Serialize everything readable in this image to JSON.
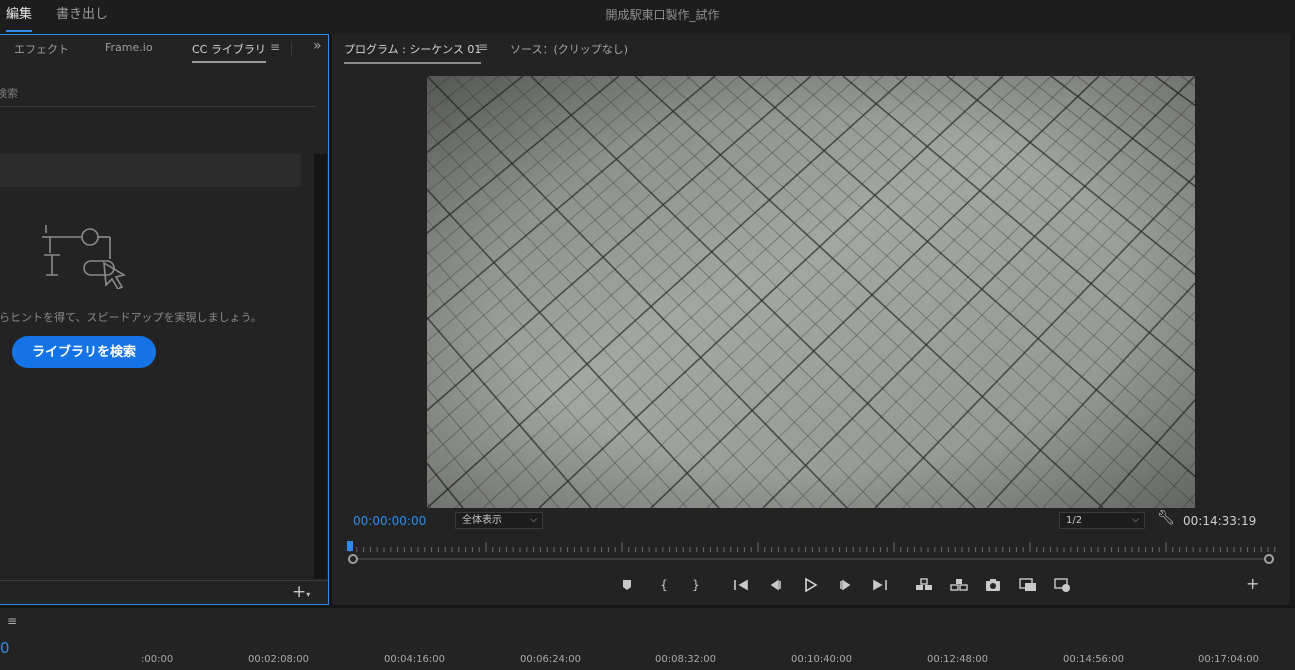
{
  "topbar": {
    "tabs": [
      {
        "label": "編集",
        "active": true
      },
      {
        "label": "書き出し",
        "active": false
      }
    ],
    "project_title": "開成駅東口製作_試作"
  },
  "left_panel": {
    "tabs": [
      "エフェクト",
      "Frame.io",
      "CC ライブラリ"
    ],
    "active_tab": "CC ライブラリ",
    "menu_icon": "hamburger-menu-icon",
    "overflow_icon": "double-chevron-right-icon",
    "search_placeholder": "検索",
    "hint_text": "からヒントを得て、スピードアップを実現しましょう。",
    "search_button_label": "ライブラリを検索",
    "add_icon": "plus-icon"
  },
  "program_monitor": {
    "program_tab": "プログラム : シーケンス 01",
    "source_tab": "ソース：(クリップなし)",
    "current_timecode": "00:00:00:00",
    "fit_value": "全体表示",
    "quality_value": "1/2",
    "duration_timecode": "00:14:33:19",
    "accent_color": "#2d8ceb",
    "controls": [
      "add-marker-icon",
      "mark-in-icon",
      "mark-out-icon",
      "go-to-in-icon",
      "step-back-icon",
      "play-icon",
      "step-forward-icon",
      "go-to-out-icon",
      "lift-icon",
      "extract-icon",
      "export-frame-icon",
      "comparison-view-icon",
      "proxy-toggle-icon"
    ]
  },
  "timeline": {
    "menu_icon": "hamburger-menu-icon",
    "timecode": "0",
    "ruler_labels": [
      ":00:00",
      "00:02:08:00",
      "00:04:16:00",
      "00:06:24:00",
      "00:08:32:00",
      "00:10:40:00",
      "00:12:48:00",
      "00:14:56:00",
      "00:17:04:00"
    ]
  }
}
